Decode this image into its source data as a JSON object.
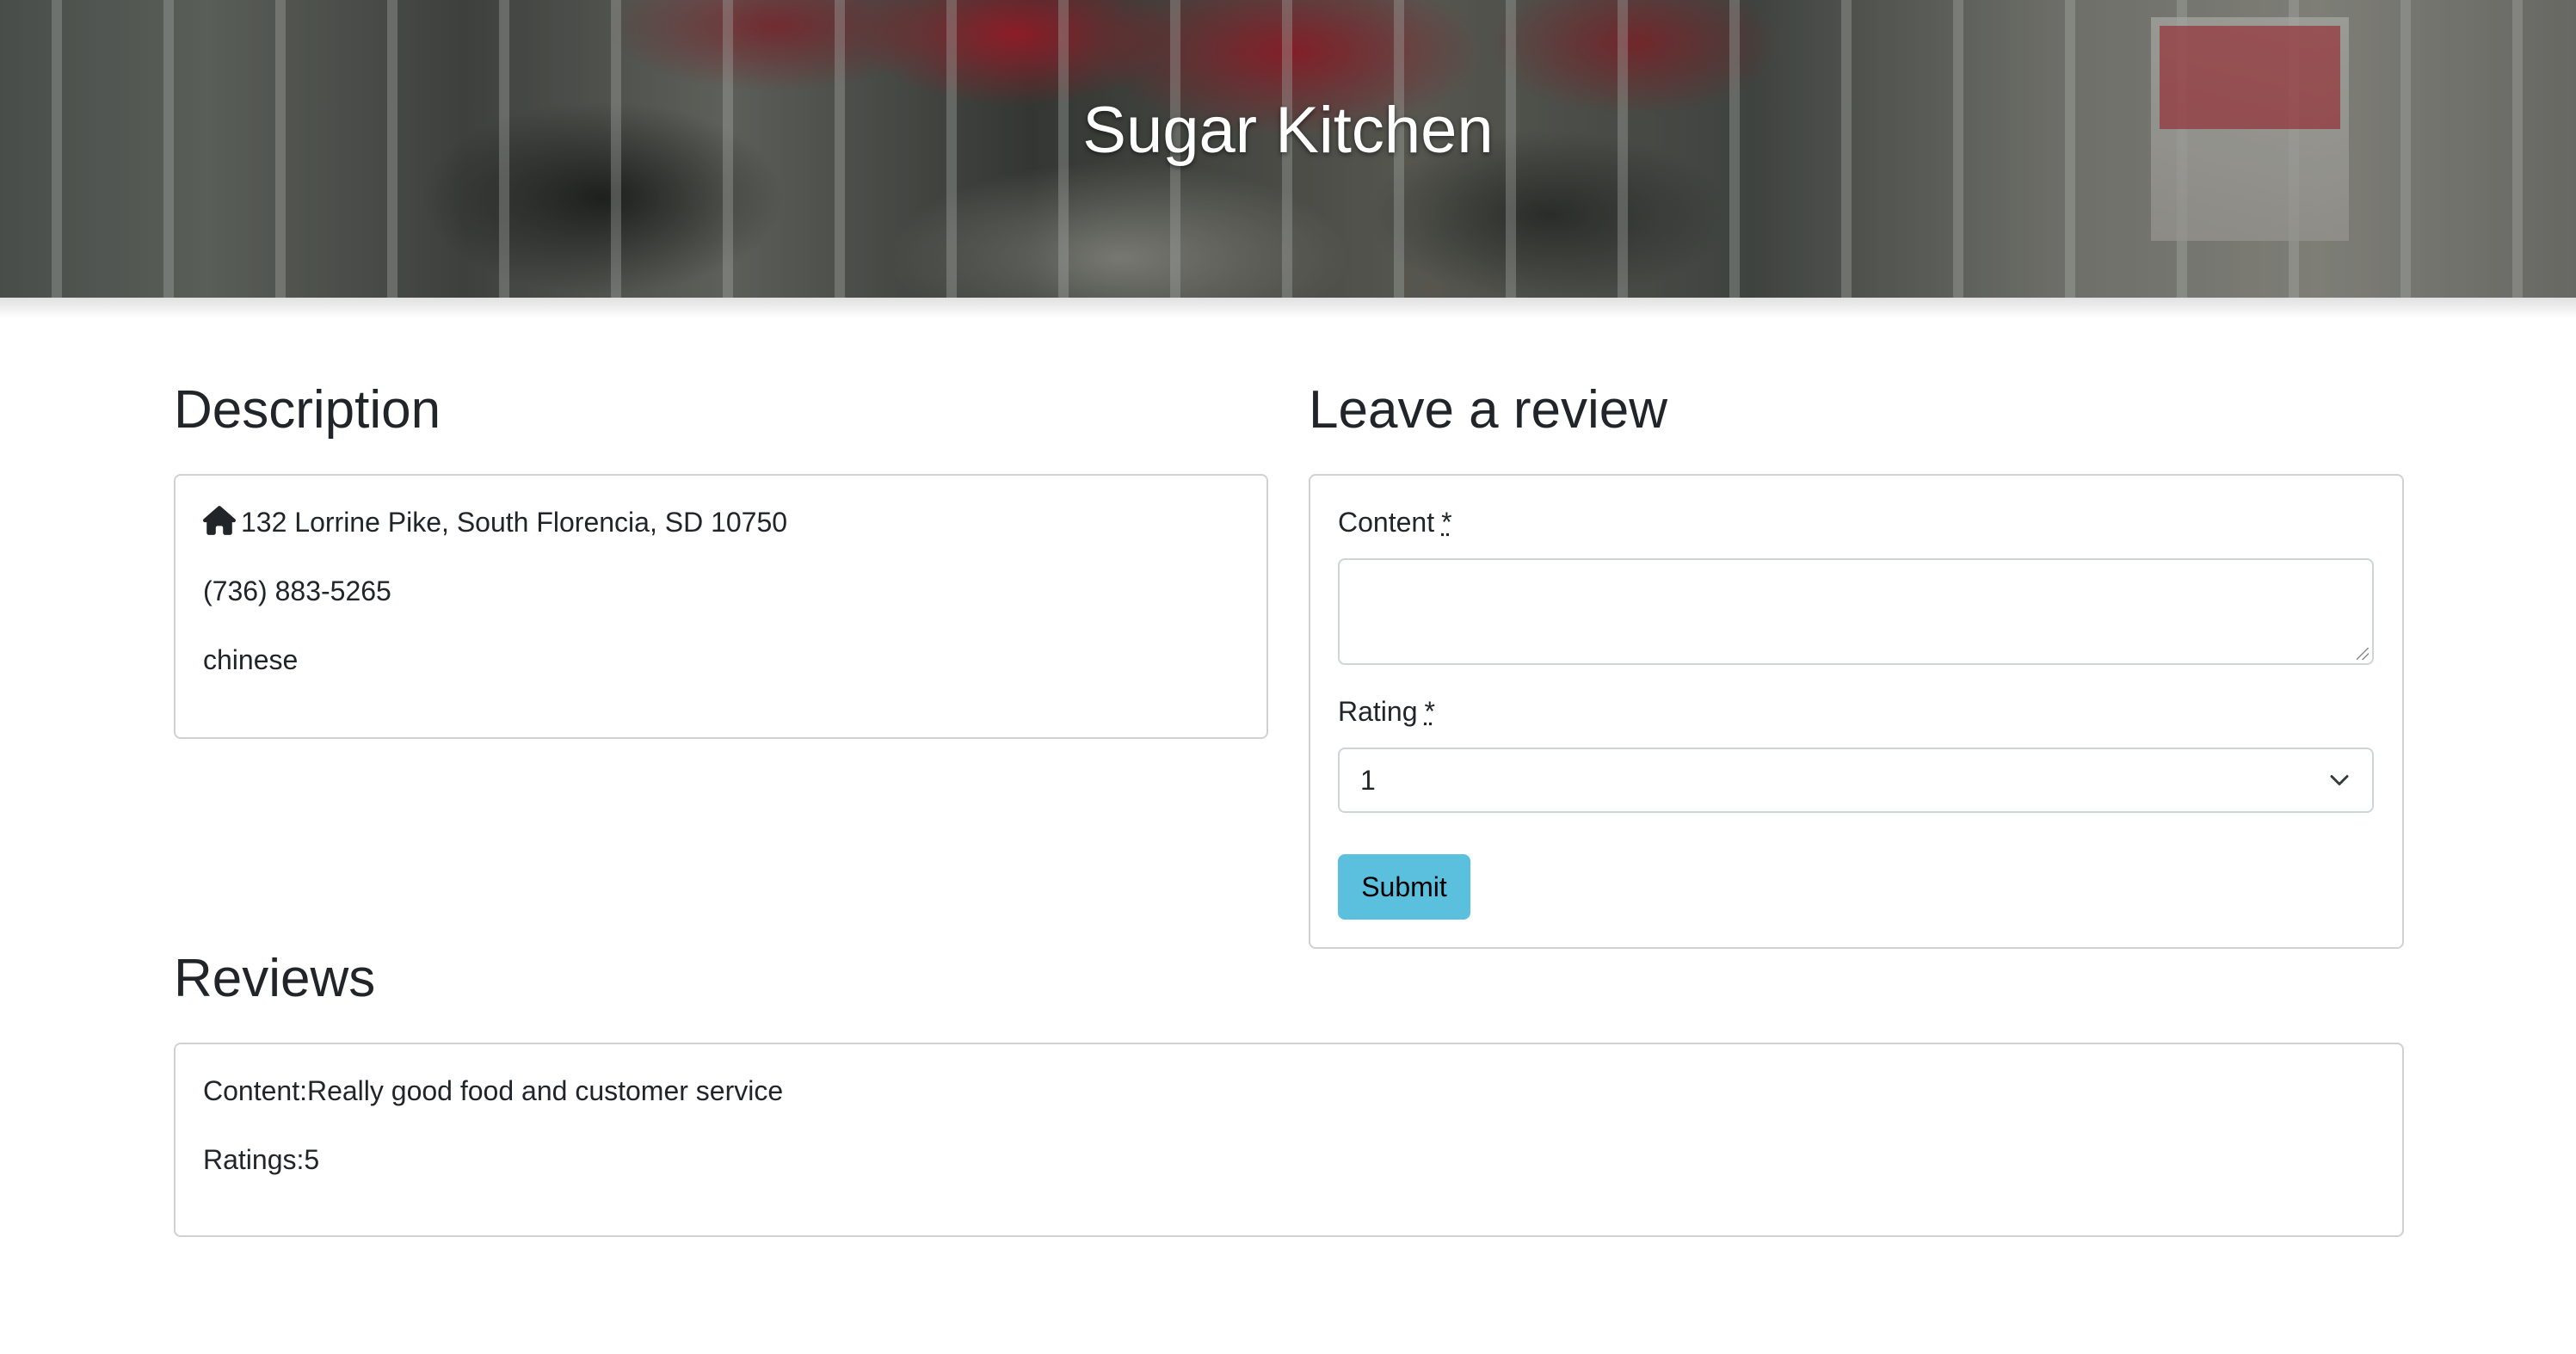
{
  "hero": {
    "title": "Sugar Kitchen"
  },
  "description": {
    "heading": "Description",
    "address_icon": "home-icon",
    "address": "132 Lorrine Pike, South Florencia, SD 10750",
    "phone": "(736) 883-5265",
    "cuisine": "chinese"
  },
  "review_form": {
    "heading": "Leave a review",
    "content_label": "Content",
    "rating_label": "Rating",
    "required_marker": "*",
    "content_value": "",
    "rating_selected": "1",
    "submit_label": "Submit",
    "submit_color": "#5bc0de"
  },
  "reviews": {
    "heading": "Reviews",
    "items": [
      {
        "content": "Content:Really good food and customer service",
        "rating": "Ratings:5"
      }
    ]
  }
}
